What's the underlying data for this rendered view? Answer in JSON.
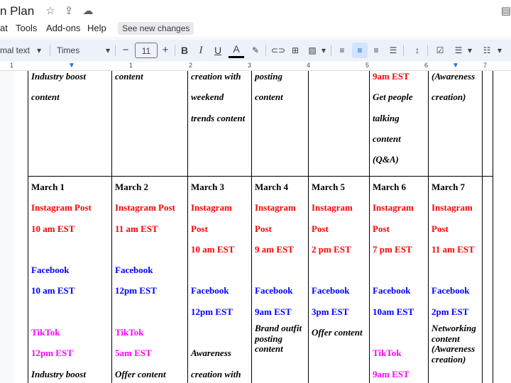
{
  "title": {
    "text": "n  Plan"
  },
  "menu": {
    "items": [
      "at",
      "Tools",
      "Add-ons",
      "Help"
    ],
    "see_changes": "See new changes"
  },
  "toolbar": {
    "style": "mal text",
    "font": "Times New...",
    "size": "11"
  },
  "ruler": {
    "numbers": [
      "1",
      "1",
      "2",
      "3",
      "4",
      "5",
      "6",
      "7"
    ]
  },
  "table": {
    "row0": [
      [
        "Industry boost",
        "content"
      ],
      [
        "content"
      ],
      [
        "creation with",
        "weekend",
        "trends content"
      ],
      [
        "posting",
        "content"
      ],
      [],
      [
        "9am EST",
        "Get people",
        "talking",
        "content",
        "(Q&A)"
      ],
      [
        "(Awareness",
        "creation)"
      ]
    ],
    "days": [
      {
        "date": "March 1",
        "ig1": "Instagram Post",
        "ig2": "",
        "ig_time": "10 am  EST",
        "fb": "Facebook",
        "fb_time": "10 am EST",
        "tt": "TikTok",
        "tt_time": "12pm EST",
        "note1": "Industry boost",
        "note2": ""
      },
      {
        "date": "March 2",
        "ig1": "Instagram Post",
        "ig2": "",
        "ig_time": "11 am EST",
        "fb": "Facebook",
        "fb_time": "12pm EST",
        "tt": "TikTok",
        "tt_time": "5am EST",
        "note1": "Offer content",
        "note2": ""
      },
      {
        "date": "March 3",
        "ig1": "Instagram",
        "ig2": "Post",
        "ig_time": "10 am EST",
        "fb": "Facebook",
        "fb_time": "12pm EST",
        "tt": "",
        "tt_time": "Awareness",
        "note1": "creation with",
        "note2": ""
      },
      {
        "date": "March 4",
        "ig1": "Instagram",
        "ig2": "Post",
        "ig_time": " 9 am EST",
        "fb": "Facebook",
        "fb_time": "9am EST",
        "tt": "",
        "tt_time": "",
        "note1": "",
        "note2": ""
      },
      {
        "date": "March 5",
        "ig1": "Instagram",
        "ig2": "Post",
        "ig_time": "2 pm EST",
        "fb": "Facebook",
        "fb_time": "3pm EST",
        "tt": "",
        "tt_time": "",
        "note1": "",
        "note2": ""
      },
      {
        "date": "March 6",
        "ig1": "Instagram",
        "ig2": "Post",
        "ig_time": "7 pm EST",
        "fb": "Facebook",
        "fb_time": "10am EST",
        "tt": "TikTok",
        "tt_time": "9am EST",
        "note1": "",
        "note2": ""
      },
      {
        "date": "March 7",
        "ig1": "Instagram",
        "ig2": "Post",
        "ig_time": "11 am EST",
        "fb": "Facebook",
        "fb_time": "2pm EST",
        "tt": "",
        "tt_time": "",
        "note1": "",
        "note2": ""
      }
    ],
    "brand_outfit": [
      "Brand outfit",
      "posting",
      "content"
    ],
    "offer_content": "Offer content",
    "networking": [
      "Networking",
      "content",
      "(Awareness",
      "creation)"
    ]
  }
}
